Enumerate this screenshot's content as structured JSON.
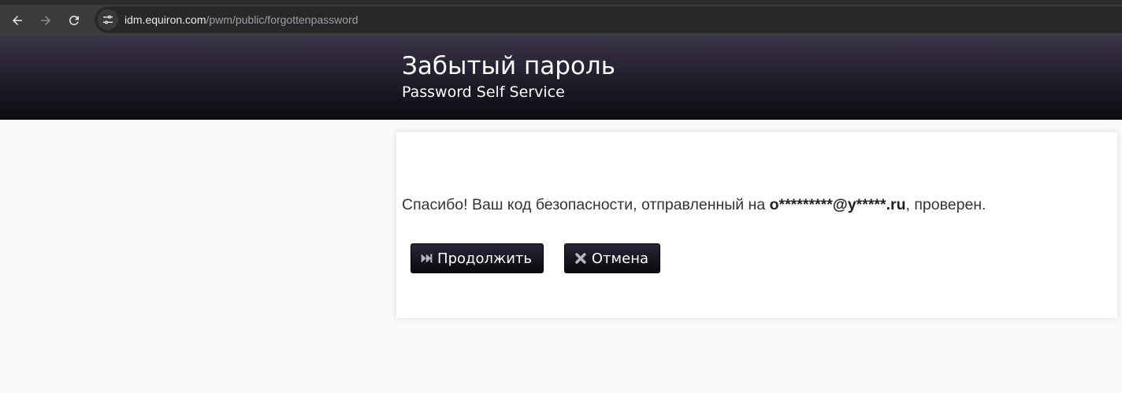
{
  "browser": {
    "url_host": "idm.equiron.com",
    "url_path": "/pwm/public/forgottenpassword"
  },
  "header": {
    "title": "Забытый пароль",
    "subtitle": "Password Self Service"
  },
  "content": {
    "message_prefix": "Спасибо! Ваш код безопасности, отправленный на ",
    "masked_email": "o*********@y*****.ru",
    "message_suffix": ", проверен."
  },
  "buttons": {
    "continue_label": "Продолжить",
    "cancel_label": "Отмена"
  },
  "icons": {
    "back": "arrow-left-icon",
    "forward": "arrow-right-icon",
    "reload": "reload-icon",
    "site_info": "tune-icon",
    "continue": "fast-forward-icon",
    "cancel": "close-icon"
  }
}
